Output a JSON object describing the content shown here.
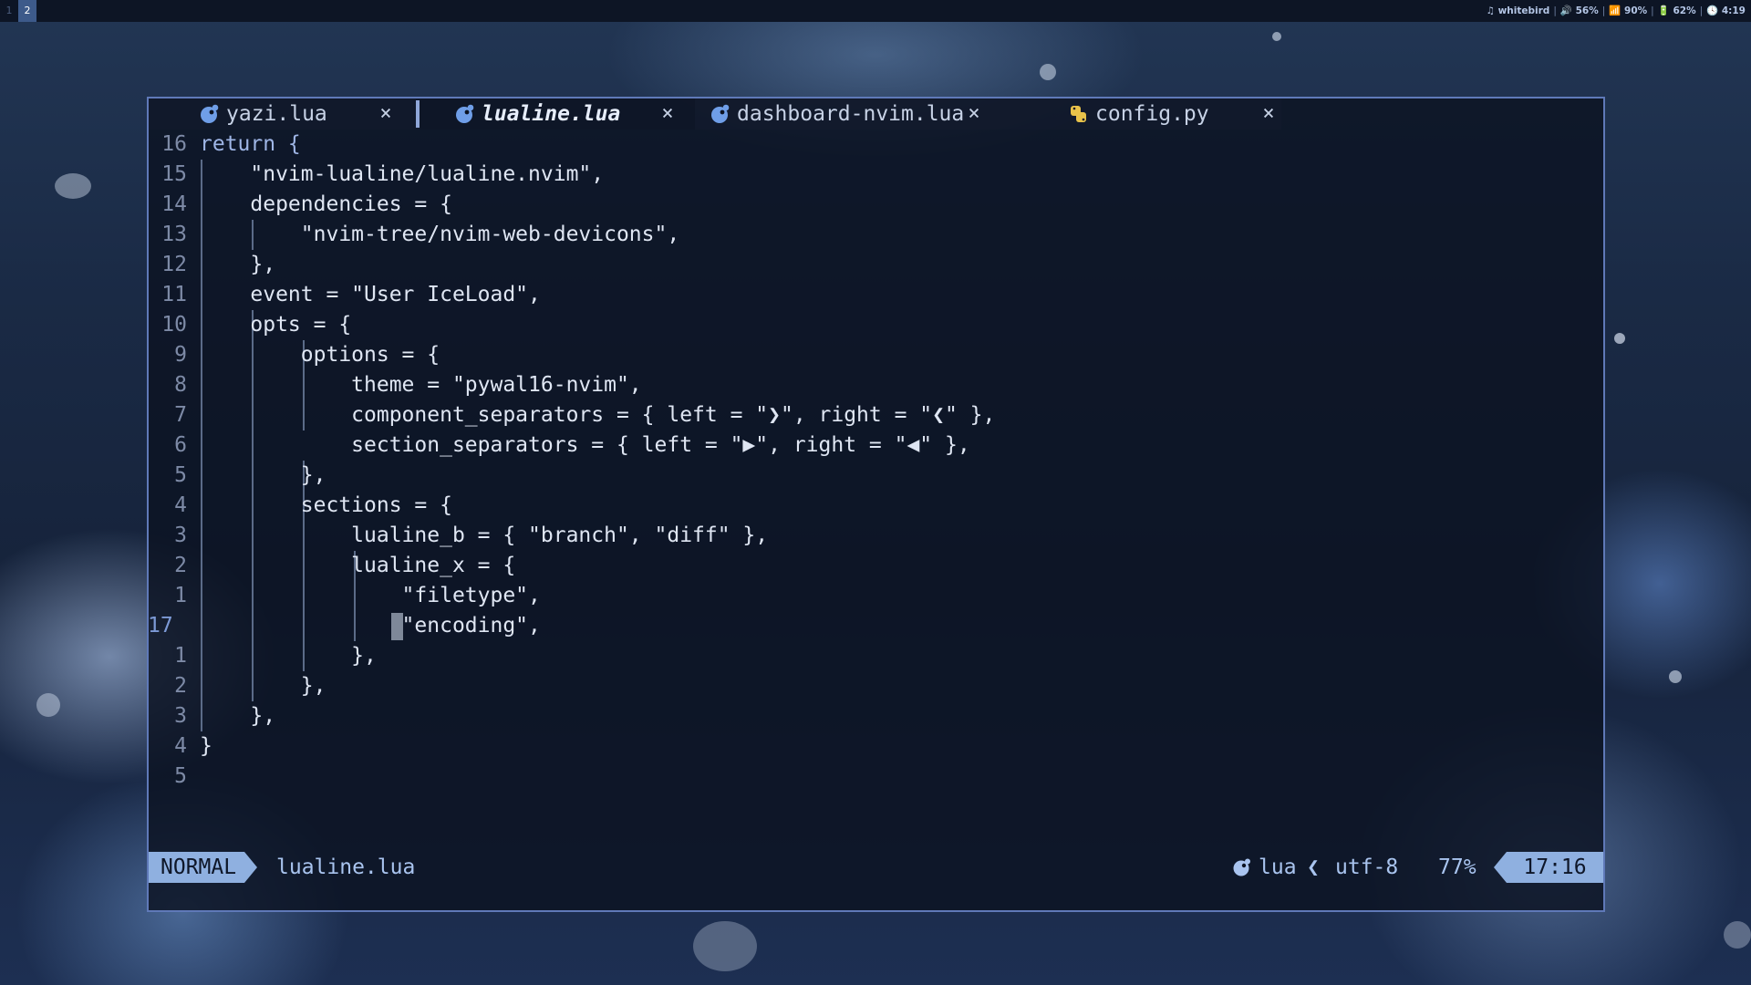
{
  "topbar": {
    "workspaces": [
      "1",
      "2"
    ],
    "active_workspace": "2",
    "music": "♫ whitebird",
    "volume": "🔊 56%",
    "wifi": "90%",
    "battery": "62%",
    "clock": "4:19"
  },
  "tabs": [
    {
      "label": "yazi.lua",
      "icon": "lua-icon",
      "close": "×"
    },
    {
      "label": "lualine.lua",
      "icon": "lua-icon",
      "close": "×",
      "active": true
    },
    {
      "label": "dashboard-nvim.lua",
      "icon": "lua-icon",
      "close": "×"
    },
    {
      "label": "config.py",
      "icon": "python-icon",
      "close": "×"
    }
  ],
  "editor": {
    "lines": [
      {
        "num": "16",
        "text": "return {"
      },
      {
        "num": "15",
        "text": "    \"nvim-lualine/lualine.nvim\","
      },
      {
        "num": "14",
        "text": "    dependencies = {"
      },
      {
        "num": "13",
        "text": "        \"nvim-tree/nvim-web-devicons\","
      },
      {
        "num": "12",
        "text": "    },"
      },
      {
        "num": "11",
        "text": "    event = \"User IceLoad\","
      },
      {
        "num": "10",
        "text": "    opts = {"
      },
      {
        "num": "9",
        "text": "        options = {"
      },
      {
        "num": "8",
        "text": "            theme = \"pywal16-nvim\","
      },
      {
        "num": "7",
        "text": "            component_separators = { left = \"❯\", right = \"❮\" },"
      },
      {
        "num": "6",
        "text": "            section_separators = { left = \"▶\", right = \"◀\" },"
      },
      {
        "num": "5",
        "text": "        },"
      },
      {
        "num": "4",
        "text": "        sections = {"
      },
      {
        "num": "3",
        "text": "            lualine_b = { \"branch\", \"diff\" },"
      },
      {
        "num": "2",
        "text": "            lualine_x = {"
      },
      {
        "num": "1",
        "text": "                \"filetype\","
      },
      {
        "num": "17",
        "text": "                \"encoding\",",
        "current": true
      },
      {
        "num": "1",
        "text": "            },"
      },
      {
        "num": "2",
        "text": "        },"
      },
      {
        "num": "3",
        "text": "    },"
      },
      {
        "num": "4",
        "text": "}"
      },
      {
        "num": "5",
        "text": ""
      }
    ]
  },
  "statusline": {
    "mode": "NORMAL",
    "filename": "lualine.lua",
    "filetype": "lua",
    "separator": "❮",
    "encoding": "utf-8",
    "progress": "77%",
    "location": "17:16"
  },
  "colors": {
    "accent": "#8fb0e0",
    "border": "#5f79b8",
    "text": "#dfe6f3"
  }
}
